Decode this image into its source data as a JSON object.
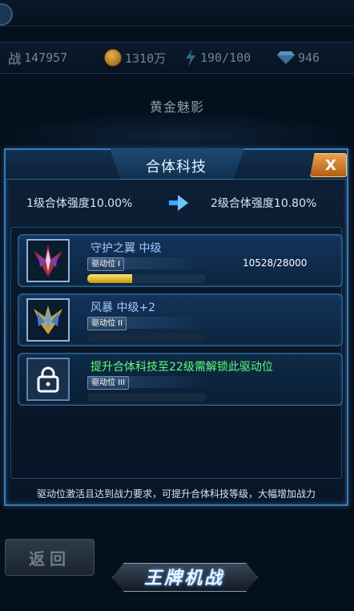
{
  "resources": {
    "power_label": "战",
    "power_value": "147957",
    "coins": "1310万",
    "energy": "190/100",
    "gems": "946"
  },
  "page_title": "黄金魅影",
  "modal": {
    "title": "合体科技",
    "close_label": "X",
    "current_strength": "1级合体强度10.00%",
    "next_strength": "2级合体强度10.80%",
    "slots": [
      {
        "name": "守护之翼 中级",
        "slot_label": "驱动位 I",
        "progress_text": "10528/28000",
        "progress_fraction": 0.376,
        "icon": "wing-ship-icon"
      },
      {
        "name": "风暴 中级+2",
        "slot_label": "驱动位 II",
        "icon": "storm-ship-icon"
      },
      {
        "name": "提升合体科技至22级需解锁此驱动位",
        "slot_label": "驱动位 III",
        "icon": "lock-icon"
      }
    ],
    "footer_note": "驱动位激活且达到战力要求，可提升合体科技等级，大幅增加战力"
  },
  "back_label": "返回",
  "logo_text": "王牌机战"
}
